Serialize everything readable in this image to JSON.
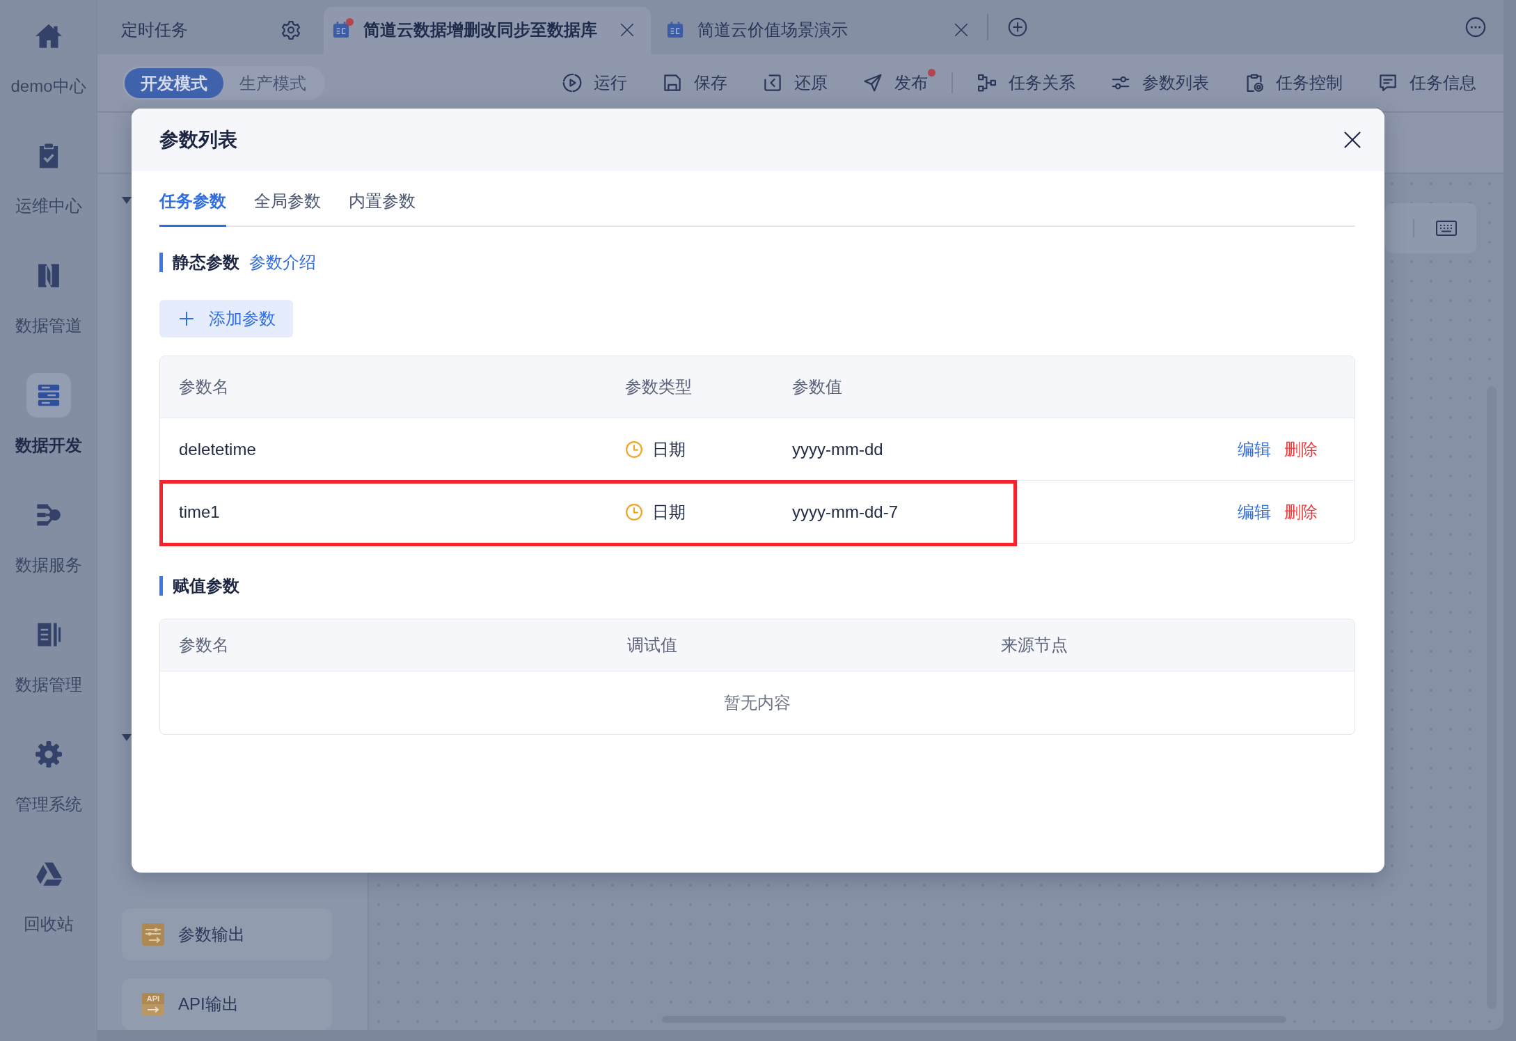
{
  "nav": {
    "items": [
      {
        "label": "demo中心",
        "selected": false
      },
      {
        "label": "运维中心",
        "selected": false
      },
      {
        "label": "数据管道",
        "selected": false
      },
      {
        "label": "数据开发",
        "selected": true
      },
      {
        "label": "数据服务",
        "selected": false
      },
      {
        "label": "数据管理",
        "selected": false
      },
      {
        "label": "管理系统",
        "selected": false
      },
      {
        "label": "回收站",
        "selected": false
      }
    ]
  },
  "tabs": [
    {
      "kind": "settings",
      "label": "定时任务",
      "selected": false
    },
    {
      "kind": "task",
      "label": "简道云数据增删改同步至数据库",
      "selected": true,
      "modified": true
    },
    {
      "kind": "task",
      "label": "简道云价值场景演示",
      "selected": false,
      "modified": false
    }
  ],
  "modes": [
    {
      "label": "开发模式",
      "selected": true
    },
    {
      "label": "生产模式",
      "selected": false
    }
  ],
  "toolbar": {
    "groups": [
      [
        {
          "label": "运行",
          "dot": false
        },
        {
          "label": "保存",
          "dot": false
        },
        {
          "label": "还原",
          "dot": false
        },
        {
          "label": "发布",
          "dot": true
        }
      ],
      [
        {
          "label": "任务关系",
          "dot": false
        },
        {
          "label": "参数列表",
          "dot": false
        },
        {
          "label": "任务控制",
          "dot": false
        },
        {
          "label": "任务信息",
          "dot": false
        }
      ]
    ]
  },
  "components": [
    {
      "kind": "params",
      "label": "参数输出"
    },
    {
      "kind": "api",
      "label": "API输出",
      "icon_text": "API"
    }
  ],
  "modal": {
    "title": "参数列表",
    "tabs": [
      {
        "label": "任务参数",
        "selected": true
      },
      {
        "label": "全局参数",
        "selected": false
      },
      {
        "label": "内置参数",
        "selected": false
      }
    ],
    "static": {
      "title": "静态参数",
      "link": "参数介绍",
      "add_button": "添加参数",
      "columns": [
        "参数名",
        "参数类型",
        "参数值"
      ],
      "rows": [
        {
          "name": "deletetime",
          "type": "日期",
          "value": "yyyy-mm-dd",
          "highlighted": false,
          "actions": [
            {
              "kind": "edit",
              "label": "编辑"
            },
            {
              "kind": "delete",
              "label": "删除"
            }
          ]
        },
        {
          "name": "time1",
          "type": "日期",
          "value": "yyyy-mm-dd-7",
          "highlighted": true,
          "actions": [
            {
              "kind": "edit",
              "label": "编辑"
            },
            {
              "kind": "delete",
              "label": "删除"
            }
          ]
        }
      ]
    },
    "assigned": {
      "title": "赋值参数",
      "columns": [
        "参数名",
        "调试值",
        "来源节点"
      ],
      "empty_text": "暂无内容"
    }
  }
}
